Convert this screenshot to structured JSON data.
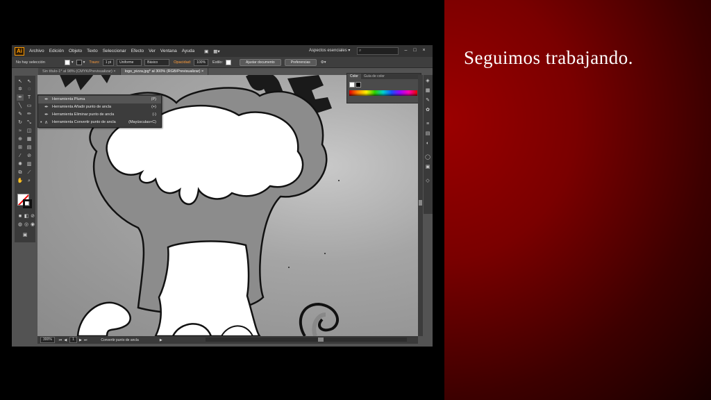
{
  "slide": {
    "title": "Seguimos trabajando."
  },
  "menubar": {
    "logo": "Ai",
    "items": [
      "Archivo",
      "Edición",
      "Objeto",
      "Texto",
      "Seleccionar",
      "Efecto",
      "Ver",
      "Ventana",
      "Ayuda"
    ],
    "workspace": "Aspectos esenciales ▾",
    "window_buttons": [
      "–",
      "□",
      "×"
    ]
  },
  "controlbar": {
    "no_selection": "No hay selección",
    "stroke_label": "Trazo:",
    "stroke_weight": "1 pt",
    "profile": "Uniforme",
    "brush": "Básico",
    "opacity_label": "Opacidad:",
    "opacity_value": "100%",
    "style_label": "Estilo:",
    "doc_setup_button": "Ajustar documento",
    "prefs_button": "Preferencias"
  },
  "tabs": [
    {
      "label": "Sin título-1* al 98% (CMYK/Previsualizar)  ×",
      "active": false
    },
    {
      "label": "logo_pizza.jpg* al 300% (RGB/Previsualizar)  ×",
      "active": true
    }
  ],
  "color_panel": {
    "tabs": [
      "Color",
      "Guía de color"
    ]
  },
  "pen_flyout": {
    "items": [
      {
        "label": "Herramienta Pluma",
        "shortcut": "(P)",
        "icon": "pen-icon"
      },
      {
        "label": "Herramienta Añadir punto de ancla",
        "shortcut": "(+)",
        "icon": "add-anchor-icon"
      },
      {
        "label": "Herramienta Eliminar punto de ancla",
        "shortcut": "(-)",
        "icon": "delete-anchor-icon"
      },
      {
        "label": "Herramienta Convertir punto de ancla",
        "shortcut": "(Mayúsculas+C)",
        "icon": "convert-anchor-icon"
      }
    ]
  },
  "statusbar": {
    "zoom": "300%",
    "page": "1",
    "status_text": "Convertir punto de ancla"
  }
}
